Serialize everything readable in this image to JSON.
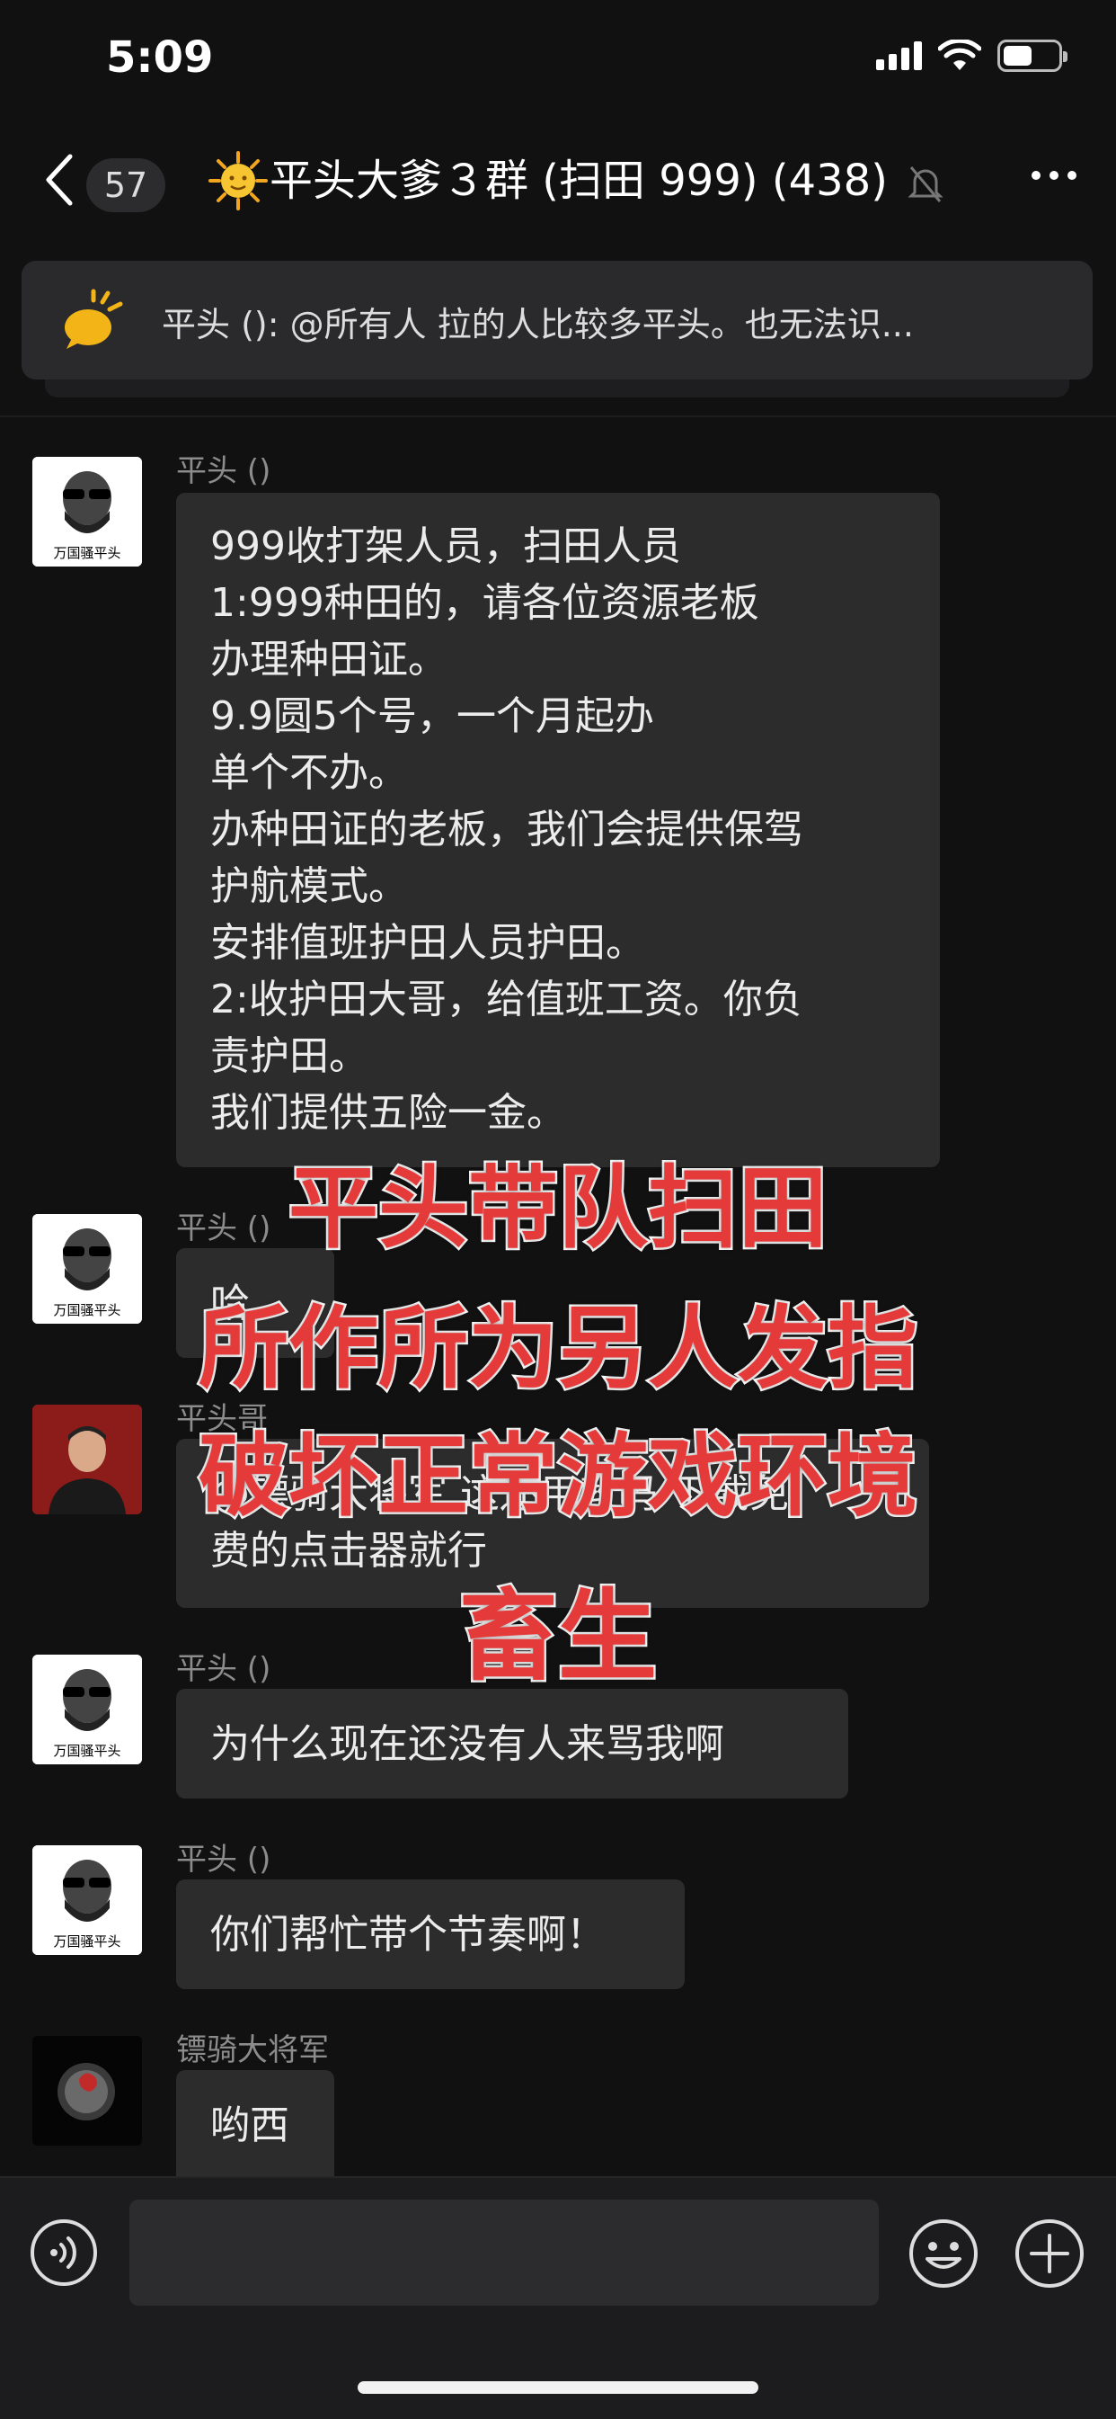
{
  "status_bar": {
    "time": "5:09",
    "battery_level": 0.55
  },
  "nav": {
    "unread_count": "57",
    "title": "平头大爹３群 (扫田 999) (438)",
    "title_icon": "sun-emoji-icon",
    "muted_icon": "bell-slash-icon"
  },
  "notice": {
    "icon": "megaphone-icon",
    "text": "平头 (): @所有人 拉的人比较多平头。也无法识..."
  },
  "messages": [
    {
      "sender": "平头 ()",
      "avatar_caption": "万国骚平头",
      "lines": [
        "999收打架人员，扫田人员",
        "1:999种田的，请各位资源老板",
        "办理种田证。",
        "9.9圆5个号，一个月起办",
        "单个不办。",
        "办种田证的老板，我们会提供保驾",
        "护航模式。",
        "安排值班护田人员护田。",
        "2:收护田大哥，给值班工资。你负",
        "责护田。",
        "我们提供五险一金。"
      ]
    },
    {
      "sender": "平头 ()",
      "avatar_caption": "万国骚平头",
      "lines": [
        "哈"
      ]
    },
    {
      "sender": "平头哥",
      "lines": [
        "@镖骑大将军 这还用教吗 下载免",
        "费的点击器就行"
      ]
    },
    {
      "sender": "平头 ()",
      "avatar_caption": "万国骚平头",
      "lines": [
        "为什么现在还没有人来骂我啊"
      ]
    },
    {
      "sender": "平头 ()",
      "avatar_caption": "万国骚平头",
      "lines": [
        "你们帮忙带个节奏啊！"
      ]
    },
    {
      "sender": "镖骑大将军",
      "lines": [
        "哟西"
      ]
    }
  ],
  "overlay": {
    "color": "#e53a3a",
    "lines": [
      "平头带队扫田",
      "所作所为另人发指",
      "破坏正常游戏环境",
      "畜生"
    ]
  },
  "input_bar": {
    "voice_icon": "voice-icon",
    "emoji_icon": "smiley-icon",
    "plus_icon": "plus-circle-icon",
    "input_value": ""
  }
}
